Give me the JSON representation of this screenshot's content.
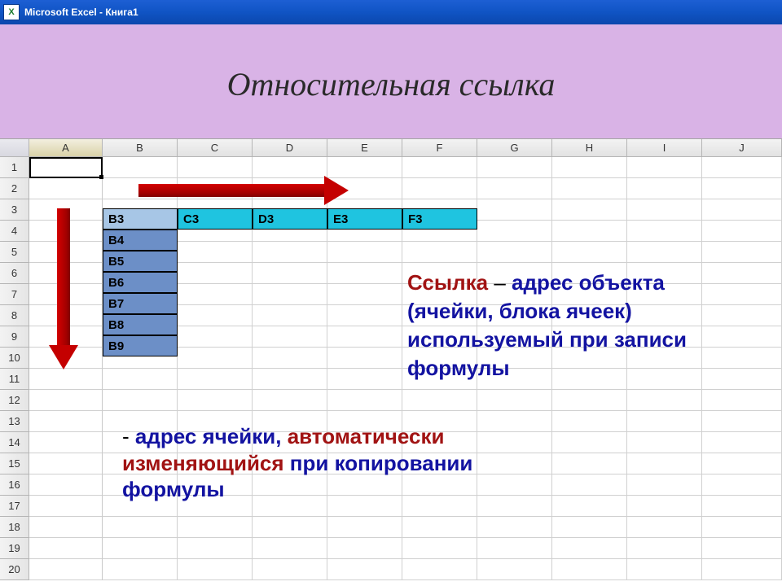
{
  "titlebar": {
    "app_icon_letter": "X",
    "text": "Microsoft Excel - Книга1"
  },
  "slide": {
    "title": "Относительная ссылка"
  },
  "sheet": {
    "columns": [
      "A",
      "B",
      "C",
      "D",
      "E",
      "F",
      "G",
      "H",
      "I",
      "J"
    ],
    "rows": [
      "1",
      "2",
      "3",
      "4",
      "5",
      "6",
      "7",
      "8",
      "9",
      "10",
      "11",
      "12",
      "13",
      "14",
      "15",
      "16",
      "17",
      "18",
      "19",
      "20"
    ]
  },
  "demo": {
    "vertical": [
      "B3",
      "B4",
      "B5",
      "B6",
      "B7",
      "B8",
      "B9"
    ],
    "horizontal": [
      "C3",
      "D3",
      "E3",
      "F3"
    ]
  },
  "definition1": {
    "part1": "Ссылка",
    "sep": " – ",
    "part2": "адрес объекта (ячейки, блока ячеек) используемый при записи формулы"
  },
  "definition2": {
    "dash": "- ",
    "part1": "адрес ячейки, ",
    "part2": "автоматически изменяющийся ",
    "part3": "при копировании формулы"
  }
}
